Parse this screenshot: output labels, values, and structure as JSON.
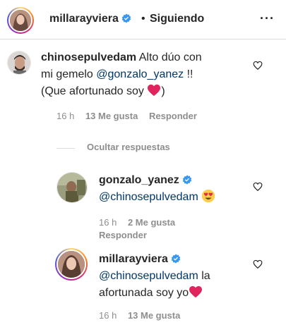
{
  "header": {
    "username": "millarayviera",
    "separator": "•",
    "follow_label": "Siguiendo",
    "more_label": "···"
  },
  "comments": [
    {
      "username": "chinosepulvedam",
      "text_line1": "Alto dúo con",
      "text_line2_prefix": "mi gemelo ",
      "mention": "@gonzalo_yanez",
      "text_line2_suffix": " !!",
      "text_line3": "(Que afortunado soy ",
      "text_line3_end": ")",
      "time": "16 h",
      "likes": "13 Me gusta",
      "reply_label": "Responder"
    }
  ],
  "hide_replies_label": "Ocultar respuestas",
  "replies": [
    {
      "username": "gonzalo_yanez",
      "mention": "@chinosepulvedam",
      "time": "16 h",
      "likes": "2 Me gusta",
      "reply_label": "Responder"
    },
    {
      "username": "millarayviera",
      "mention": "@chinosepulvedam",
      "text_after_mention": " la",
      "text_line2": "afortunada soy yo",
      "time": "16 h",
      "likes": "13 Me gusta"
    }
  ],
  "icons": {
    "verified": "verified-badge-icon",
    "like": "heart-outline-icon",
    "red_heart": "red-heart-emoji",
    "heart_eyes": "heart-eyes-emoji",
    "more": "more-options-icon"
  },
  "colors": {
    "verified_blue": "#3897f0",
    "mention": "#00376b",
    "meta_gray": "#8e8e8e",
    "heart_red": "#e0245e"
  }
}
